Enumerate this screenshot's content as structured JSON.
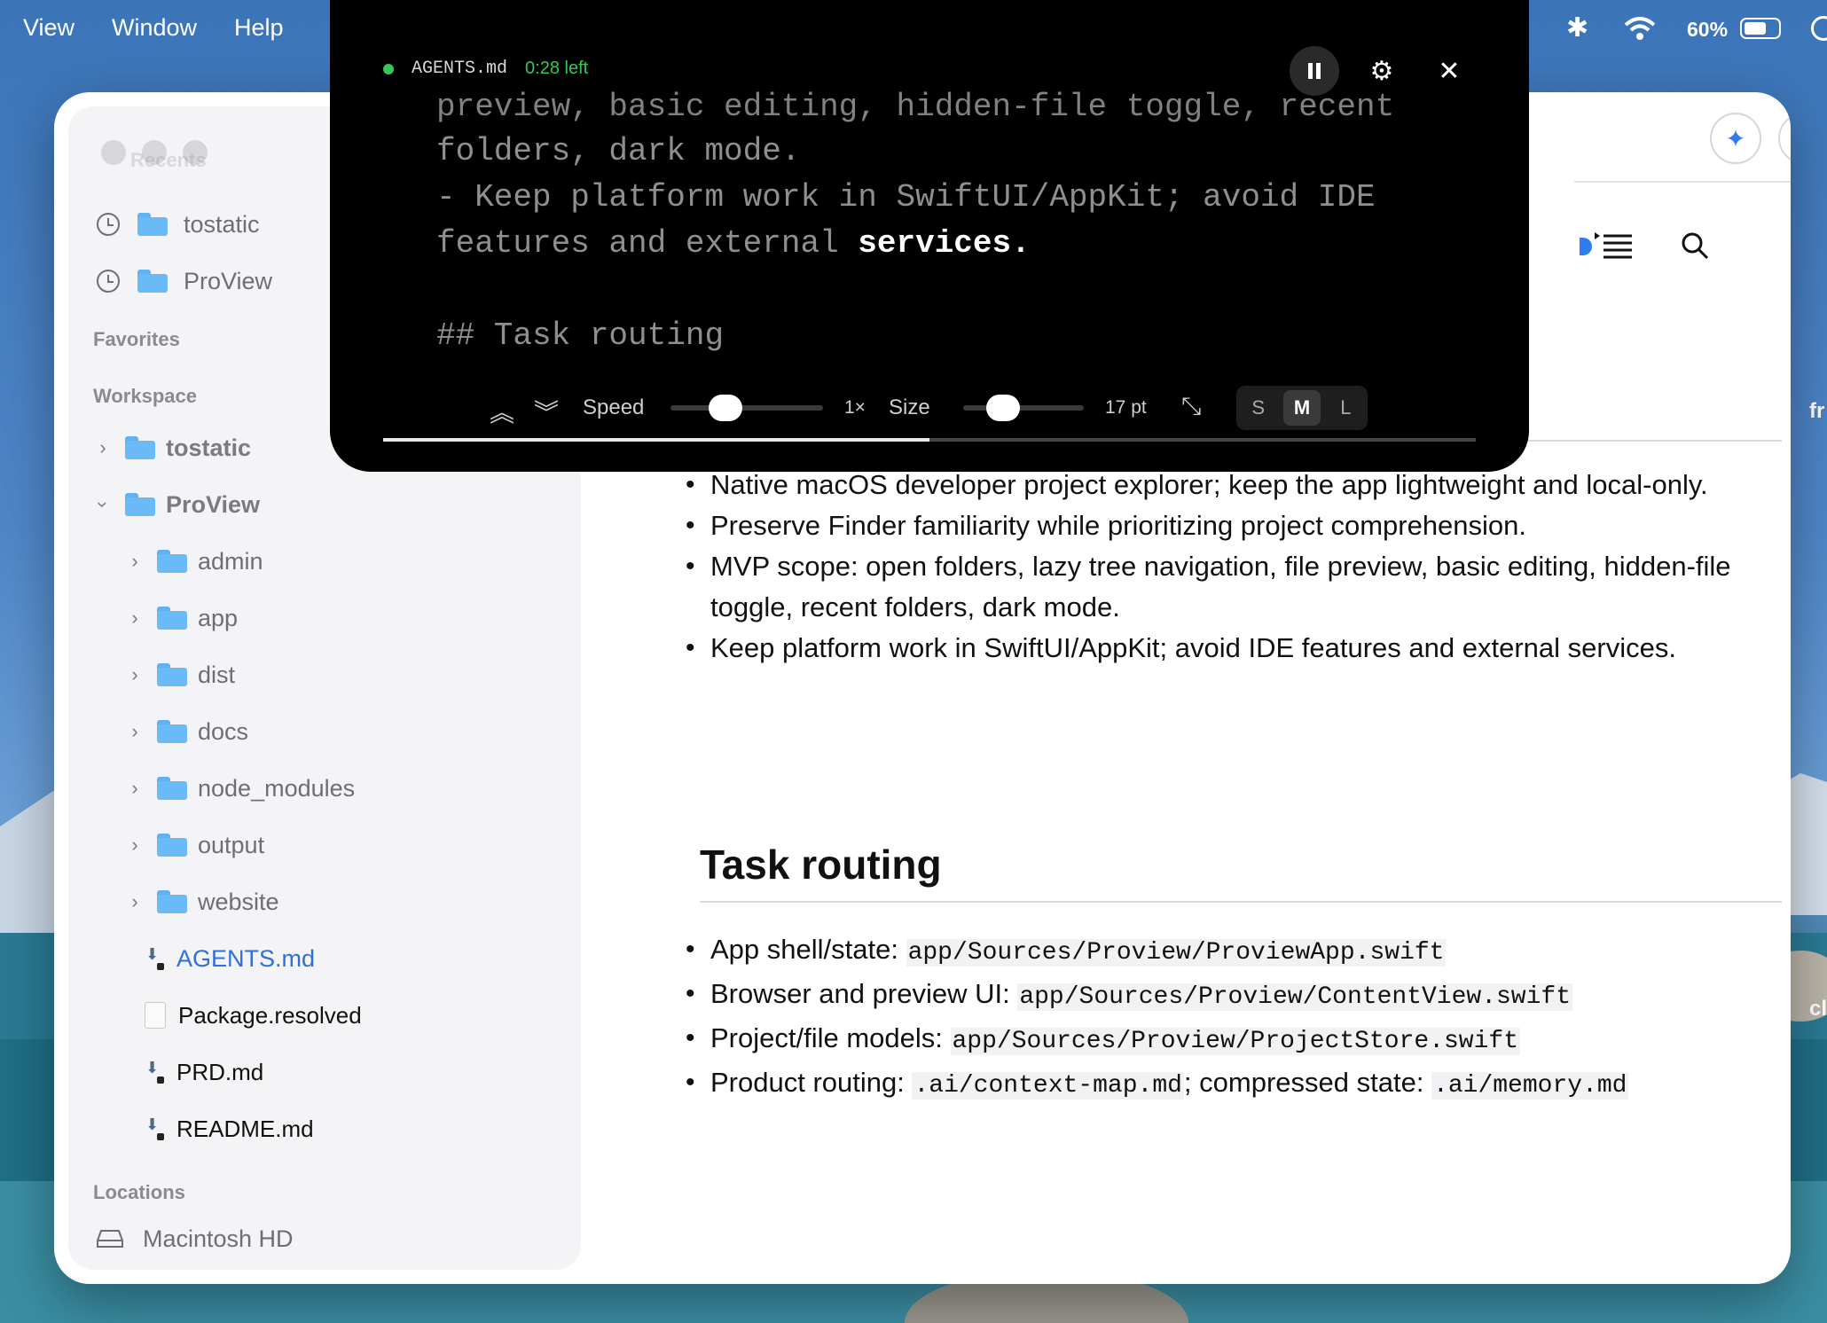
{
  "menubar": {
    "items": [
      "View",
      "Window",
      "Help"
    ],
    "battery": "60%"
  },
  "sidebar": {
    "recents_header": "Recents",
    "recents": [
      "tostatic",
      "ProView"
    ],
    "favorites_header": "Favorites",
    "workspace_header": "Workspace",
    "workspace": [
      {
        "label": "tostatic",
        "expanded": false
      },
      {
        "label": "ProView",
        "expanded": true
      }
    ],
    "proview_children": [
      "admin",
      "app",
      "dist",
      "docs",
      "node_modules",
      "output",
      "website"
    ],
    "files": [
      {
        "label": "AGENTS.md",
        "selected": true
      },
      {
        "label": "Package.resolved",
        "selected": false
      },
      {
        "label": "PRD.md",
        "selected": false
      },
      {
        "label": "README.md",
        "selected": false
      }
    ],
    "locations_header": "Locations",
    "locations": [
      "Macintosh HD"
    ]
  },
  "document": {
    "bullets_1": [
      "Native macOS developer project explorer; keep the app lightweight and local-only.",
      "Preserve Finder familiarity while prioritizing project comprehension.",
      "MVP scope: open folders, lazy tree navigation, file preview, basic editing, hidden-file toggle, recent folders, dark mode.",
      "Keep platform work in SwiftUI/AppKit; avoid IDE features and external services."
    ],
    "heading_task_routing": "Task routing",
    "routing": [
      {
        "label": "App shell/state: ",
        "code": "app/Sources/Proview/ProviewApp.swift"
      },
      {
        "label": "Browser and preview UI: ",
        "code": "app/Sources/Proview/ContentView.swift"
      },
      {
        "label": "Project/file models: ",
        "code": "app/Sources/Proview/ProjectStore.swift"
      }
    ],
    "routing_last": {
      "label": "Product routing: ",
      "code1": ".ai/context-map.md",
      "mid": "; compressed state: ",
      "code2": ".ai/memory.md"
    }
  },
  "teleprompter": {
    "file": "AGENTS.md",
    "time_left": "0:28 left",
    "lines": [
      "preview, basic editing, hidden-file toggle, recent",
      "folders, dark mode.",
      "- Keep platform work in SwiftUI/AppKit; avoid IDE",
      "features and external ",
      "## Task routing"
    ],
    "highlight_word": "services.",
    "speed_label": "Speed",
    "speed_value": "1×",
    "speed_level": 0.32,
    "size_label": "Size",
    "size_value": "17 pt",
    "size_level": 0.27,
    "size_presets": [
      "S",
      "M",
      "L"
    ],
    "size_preset_active": "M",
    "progress": 0.5
  },
  "peek_right": [
    "fr",
    "cl"
  ]
}
